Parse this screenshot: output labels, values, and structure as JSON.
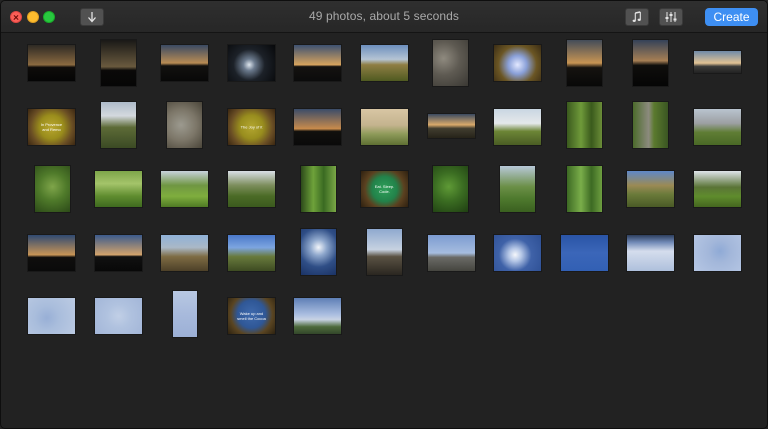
{
  "window": {
    "title": "49 photos, about 5 seconds",
    "create_label": "Create"
  },
  "icons": {
    "close": "close-icon",
    "minimize": "minimize-icon",
    "zoom": "zoom-icon",
    "download": "arrow-down-icon",
    "music": "music-note-icon",
    "adjust": "sliders-icon"
  },
  "colors": {
    "accent": "#3e8ff3",
    "background": "#222222"
  },
  "photos": [
    {
      "bg": "linear-gradient(#2e2a24 0%,#8a6a40 55%,#0e0c0a 62%,#050505 100%)"
    },
    {
      "bg": "linear-gradient(#1a1917 0%,#6a5a3e 58%,#0a0908 66%,#060606 100%)"
    },
    {
      "bg": "linear-gradient(#3b4a63 0%,#b98c54 50%,#12110f 58%,#080808 100%)"
    },
    {
      "bg": "radial-gradient(circle at 45% 55%,#dfe7ef 0%,#6b7a8d 18%,#1c2128 48%,#07080a 100%)"
    },
    {
      "bg": "linear-gradient(#3e5272 0%,#d6a35e 55%,#141210 60%,#0b0b0b 100%)"
    },
    {
      "bg": "linear-gradient(#6c8fbd 0%,#b5c4d4 40%,#8f7e43 55%,#4f5a21 100%)"
    },
    {
      "bg": "radial-gradient(circle at 30% 40%,#8f8a7f 0%,#5e5a52 45%,#3a3833 100%)"
    },
    {
      "bg": "radial-gradient(circle at 50% 55%,#e2e8ff 0%,#8aa0d8 30%,#6b5624 62%,#3a2c14 100%)"
    },
    {
      "bg": "linear-gradient(#434c59 0%,#c89553 50%,#15130f 60%,#080808 100%)"
    },
    {
      "bg": "linear-gradient(#344258 0%,#a67f54 45%,#0f0e0c 55%,#050505 100%)"
    },
    {
      "bg": "linear-gradient(#6f8aa8 0%,#e2c394 55%,#3c3c3a 70%,#222 100%)"
    },
    {
      "bg": "radial-gradient(circle at 50% 50%,#b9a72f 0%,#9a8d1c 40%,#6a4e24 70%,#3b2712 100%)",
      "text": "In Provence and Remo"
    },
    {
      "bg": "linear-gradient(#aebbc9 0%,#d4d9de 30%,#5d6b37 55%,#3b4a24 100%)"
    },
    {
      "bg": "radial-gradient(circle at 40% 50%,#9c9a8f 0%,#7c7668 50%,#4a4539 100%)"
    },
    {
      "bg": "radial-gradient(circle at 50% 50%,#b3a630 0%,#988d1e 40%,#6b4f25 70%,#3a2611 100%)",
      "text": "The Joy of it"
    },
    {
      "bg": "linear-gradient(#3b4c69 0%,#c88b4c 55%,#11100d 62%,#0a0a0a 100%)"
    },
    {
      "bg": "linear-gradient(#d8c6a4 0%,#c4b38e 45%,#8d9a59 70%,#5f7033 100%)"
    },
    {
      "bg": "linear-gradient(#3b4a60 0%,#d9a96a 45%,#413d2f 60%,#262319 100%)"
    },
    {
      "bg": "linear-gradient(#c9d6e2 0%,#e5e8ea 40%,#6c8536 62%,#4a5d24 100%)"
    },
    {
      "bg": "linear-gradient(90deg,#3b5a1e 0%,#6f9a3a 40%,#3a5a1c 70%,#6b8d38 100%)"
    },
    {
      "bg": "linear-gradient(90deg,#4c6b2b 0%,#8c8b7e 45%,#5b7a2e 60%,#3a5522 100%)"
    },
    {
      "bg": "linear-gradient(#b9c4cf 0%,#9c9fa2 40%,#5f7d34 65%,#4a6926 100%)"
    },
    {
      "bg": "radial-gradient(circle at 50% 45%,#7fa54a 0%,#4f7a2a 45%,#2c4a18 100%)"
    },
    {
      "bg": "linear-gradient(#7ea64a 0%,#a4c46a 35%,#5f8c2f 70%,#3e6a1f 100%)"
    },
    {
      "bg": "linear-gradient(#c8d2dc 0%,#6f9642 40%,#7fae3e 70%,#4f7a24 100%)"
    },
    {
      "bg": "linear-gradient(#d9dfe6 0%,#7c8d5c 40%,#4b6b26 70%,#3b5a1e 100%)"
    },
    {
      "bg": "linear-gradient(90deg,#2c4a1a 0%,#6ea23a 35%,#3a6a22 65%,#7aa846 100%)"
    },
    {
      "bg": "radial-gradient(circle at 50% 50%,#2fa05a 0%,#22824a 42%,#5b4120 66%,#2e2010 100%)",
      "text": "Eat. Sleep. Code."
    },
    {
      "bg": "radial-gradient(circle at 45% 45%,#5f9a36 0%,#3b6d22 45%,#1f3f12 100%)"
    },
    {
      "bg": "linear-gradient(#b8c8d8 0%,#6b8f47 45%,#4f7a2e 70%,#3a6020 100%)"
    },
    {
      "bg": "linear-gradient(90deg,#3d6a24 0%,#7aae4a 40%,#3c6a23 70%,#6e9f40 100%)"
    },
    {
      "bg": "linear-gradient(#5f88c8 0%,#9b8a55 40%,#6a7a3a 65%,#4a5a26 100%)"
    },
    {
      "bg": "linear-gradient(#dfe4ea 0%,#5a7436 45%,#5f8c2d 70%,#44661f 100%)"
    },
    {
      "bg": "linear-gradient(#304a72 0%,#c79456 55%,#0f0e0d 62%,#0a0a0a 100%)"
    },
    {
      "bg": "linear-gradient(#3c5b8c 0%,#d2a36c 55%,#111 60%,#080808 100%)"
    },
    {
      "bg": "linear-gradient(#8fb1d8 0%,#aab8c6 35%,#7e6c44 60%,#4d4028 100%)"
    },
    {
      "bg": "linear-gradient(#4a78c9 0%,#7da5e0 35%,#687a3c 60%,#3d4b22 100%)"
    },
    {
      "bg": "radial-gradient(circle at 50% 40%,#f2f5fa 0%,#8ea7cc 25%,#2f4e86 60%,#1a3264 100%)"
    },
    {
      "bg": "linear-gradient(#8fa9cf 0%,#c7d2e1 45%,#5a5243 60%,#2a2620 100%)"
    },
    {
      "bg": "linear-gradient(#7c9bd1 0%,#a6bddf 50%,#6a6a66 62%,#45453f 100%)"
    },
    {
      "bg": "radial-gradient(circle at 45% 55%,#f5f7fb 0%,#b4c6e6 20%,#3f62a8 50%,#2d4f94 100%)"
    },
    {
      "bg": "linear-gradient(#2a54a6 0%,#3b66b9 50%,#3260b4 100%)"
    },
    {
      "bg": "linear-gradient(#2d3f5e 0%,#6f88b5 20%,#d5dded 45%,#aec0dc 100%)"
    },
    {
      "bg": "radial-gradient(circle at 55% 45%,#8faad6 0%,#a3b7da 35%,#b6c7e4 100%)"
    },
    {
      "bg": "radial-gradient(circle at 40% 55%,#98afd6 0%,#a9bddc 35%,#bccbe3 100%)"
    },
    {
      "bg": "radial-gradient(circle at 50% 50%,#c1cfe6 0%,#b0c2df 40%,#a3b6d8 100%)"
    },
    {
      "bg": "linear-gradient(#b8c8e2 0%,#a8badc 50%,#9cb0d6 100%)"
    },
    {
      "bg": "radial-gradient(circle at 50% 45%,#3f6aad 0%,#2f5796 45%,#5a4522 68%,#2d2210 100%)",
      "text": "Wake up and smell the Cocoa"
    },
    {
      "bg": "linear-gradient(#5e7fb6 0%,#a9bde0 45%,#c8d3e4 60%,#4d6a3b 80%,#33472a 100%)"
    }
  ]
}
